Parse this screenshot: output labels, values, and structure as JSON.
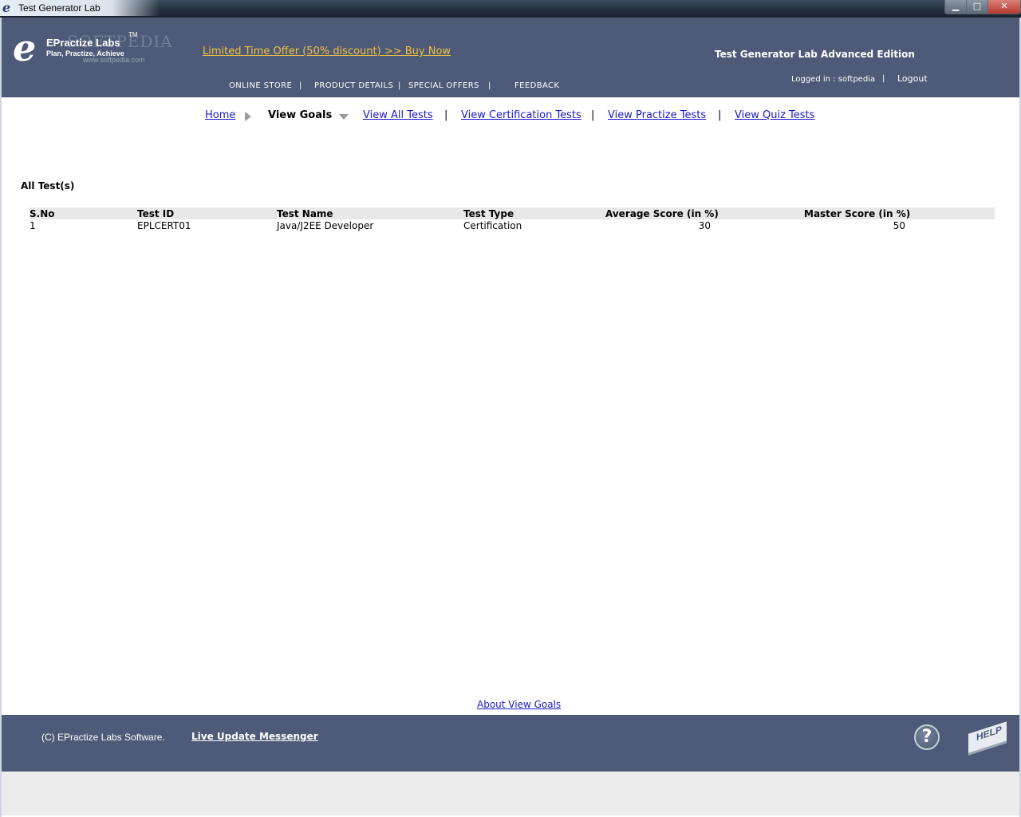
{
  "window": {
    "title": "Test Generator Lab",
    "minimize": "▁",
    "maximize": "□",
    "close": "✕"
  },
  "header": {
    "logo_letter": "e",
    "brand": "EPractize Labs",
    "tm": "TM",
    "tagline": "Plan, Practize, Achieve",
    "watermark": "SOFTPEDIA",
    "watermark_url": "www.softpedia.com",
    "offer": "Limited Time Offer (50% discount) >> Buy Now",
    "nav": [
      "ONLINE STORE",
      "|",
      "PRODUCT DETAILS",
      "|",
      "SPECIAL OFFERS",
      "|",
      "FEEDBACK"
    ],
    "edition": "Test Generator Lab Advanced Edition",
    "logged_in": "Logged in : softpedia",
    "separator": "|",
    "logout": "Logout"
  },
  "crumbs": {
    "home": "Home",
    "current": "View Goals",
    "links": [
      "View All Tests",
      "View Certification Tests",
      "View Practize Tests",
      "View Quiz Tests"
    ],
    "separator": "|"
  },
  "section_title": "All Test(s)",
  "table": {
    "columns": [
      "S.No",
      "Test ID",
      "Test Name",
      "Test Type",
      "Average Score (in %)",
      "Master Score (in %)"
    ],
    "rows": [
      [
        "1",
        "EPLCERT01",
        "Java/J2EE Developer",
        "Certification",
        "30",
        "50"
      ]
    ]
  },
  "about_link": "About View Goals",
  "footer": {
    "copyright": "(C) EPractize Labs Software.",
    "live_update": "Live Update Messenger",
    "question": "?",
    "help": "HELP"
  },
  "colors": {
    "header_bg": "#4e5a78",
    "offer": "#f0c040",
    "link": "#1a1acc",
    "table_header_bg": "#e8e8e8"
  }
}
